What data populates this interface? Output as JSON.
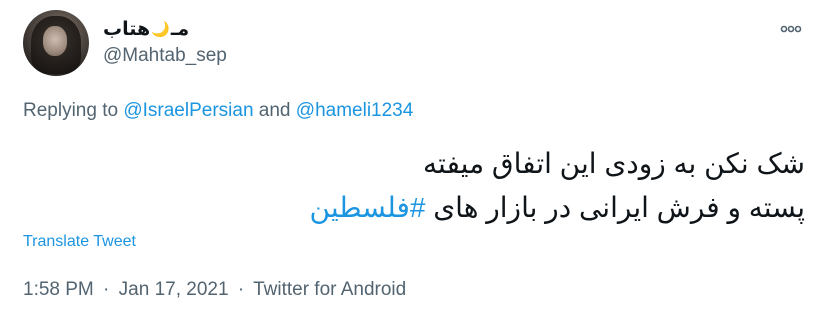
{
  "user": {
    "display_name_prefix": "مـ",
    "display_name_moon": "🌙",
    "display_name_suffix": "هتاب",
    "handle": "@Mahtab_sep"
  },
  "reply": {
    "prefix": "Replying to",
    "mention1": "@IsraelPersian",
    "conjunction": "and",
    "mention2": "@hameli1234"
  },
  "tweet": {
    "line1": "شک نکن به زودی این اتفاق میفته",
    "line2_text": "پسته و فرش ایرانی در بازار های",
    "hashtag": "#فلسطین"
  },
  "actions": {
    "translate_label": "Translate Tweet",
    "more_icon": "more-horizontal-icon"
  },
  "meta": {
    "time": "1:58 PM",
    "separator": "·",
    "date": "Jan 17, 2021",
    "source": "Twitter for Android"
  }
}
